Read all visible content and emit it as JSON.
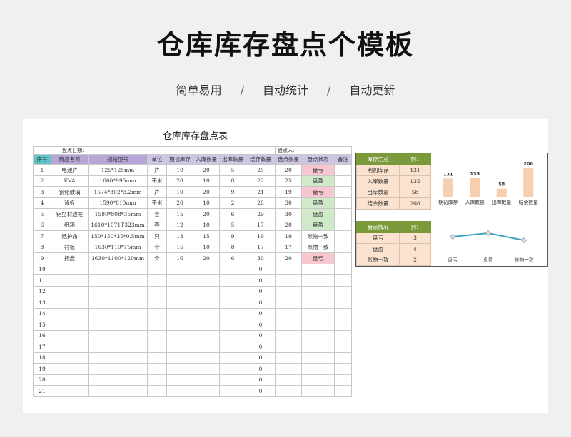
{
  "page": {
    "title": "仓库库存盘点个模板",
    "tags": [
      "简单易用",
      "自动统计",
      "自动更新"
    ],
    "separator": "/"
  },
  "sheet": {
    "title": "仓库库存盘点表",
    "date_label": "盘点日期:",
    "person_label": "盘点人:",
    "headers": [
      "序号",
      "商品名称",
      "规格型号",
      "单位",
      "期初库存",
      "入库数量",
      "出库数量",
      "结存数量",
      "盘点数量",
      "盘点状态",
      "备注"
    ],
    "rows": [
      [
        "1",
        "电池片",
        "125*125mm",
        "片",
        "10",
        "20",
        "5",
        "25",
        "20",
        "盘亏",
        ""
      ],
      [
        "2",
        "EVA",
        "1660*995mm",
        "平米",
        "20",
        "10",
        "8",
        "22",
        "25",
        "盘盈",
        ""
      ],
      [
        "3",
        "钢化玻璃",
        "1574*802*3.2mm",
        "片",
        "10",
        "20",
        "9",
        "21",
        "19",
        "盘亏",
        ""
      ],
      [
        "4",
        "背板",
        "1590*810mm",
        "平米",
        "20",
        "10",
        "2",
        "28",
        "30",
        "盘盈",
        ""
      ],
      [
        "5",
        "铝型材边框",
        "1580*808*35mm",
        "套",
        "15",
        "20",
        "6",
        "29",
        "30",
        "盘盈",
        ""
      ],
      [
        "6",
        "纸箱",
        "1610*1071T323mm",
        "套",
        "12",
        "10",
        "5",
        "17",
        "20",
        "盘盈",
        ""
      ],
      [
        "7",
        "纸护角",
        "150*150*35*0.5mm",
        "只",
        "13",
        "15",
        "9",
        "19",
        "19",
        "账物一致",
        ""
      ],
      [
        "8",
        "衬板",
        "1630*110*T5mm",
        "个",
        "15",
        "10",
        "8",
        "17",
        "17",
        "账物一致",
        ""
      ],
      [
        "9",
        "托盘",
        "1630*1100*120mm",
        "个",
        "16",
        "20",
        "6",
        "30",
        "20",
        "盘亏",
        ""
      ],
      [
        "10",
        "",
        "",
        "",
        "",
        "",
        "",
        "0",
        "",
        "",
        ""
      ],
      [
        "11",
        "",
        "",
        "",
        "",
        "",
        "",
        "0",
        "",
        "",
        ""
      ],
      [
        "12",
        "",
        "",
        "",
        "",
        "",
        "",
        "0",
        "",
        "",
        ""
      ],
      [
        "13",
        "",
        "",
        "",
        "",
        "",
        "",
        "0",
        "",
        "",
        ""
      ],
      [
        "14",
        "",
        "",
        "",
        "",
        "",
        "",
        "0",
        "",
        "",
        ""
      ],
      [
        "15",
        "",
        "",
        "",
        "",
        "",
        "",
        "0",
        "",
        "",
        ""
      ],
      [
        "16",
        "",
        "",
        "",
        "",
        "",
        "",
        "0",
        "",
        "",
        ""
      ],
      [
        "17",
        "",
        "",
        "",
        "",
        "",
        "",
        "0",
        "",
        "",
        ""
      ],
      [
        "18",
        "",
        "",
        "",
        "",
        "",
        "",
        "0",
        "",
        "",
        ""
      ],
      [
        "19",
        "",
        "",
        "",
        "",
        "",
        "",
        "0",
        "",
        "",
        ""
      ],
      [
        "20",
        "",
        "",
        "",
        "",
        "",
        "",
        "0",
        "",
        "",
        ""
      ],
      [
        "21",
        "",
        "",
        "",
        "",
        "",
        "",
        "0",
        "",
        "",
        ""
      ]
    ]
  },
  "summary": {
    "stock": {
      "header": [
        "库存汇总",
        "列1"
      ],
      "rows": [
        [
          "期初库存",
          "131"
        ],
        [
          "入库数量",
          "135"
        ],
        [
          "出库数量",
          "58"
        ],
        [
          "结余数量",
          "208"
        ]
      ]
    },
    "check": {
      "header": [
        "盘点情况",
        "列1"
      ],
      "rows": [
        [
          "盘亏",
          "3"
        ],
        [
          "盘盈",
          "4"
        ],
        [
          "账物一致",
          "2"
        ]
      ]
    }
  },
  "colors": {
    "header_teal": "#5cc6c6",
    "header_purple": "#b7a6d8",
    "loss_bg": "#f7c6cf",
    "gain_bg": "#cfe9c9",
    "summary_bg": "#fbe3d0",
    "summary_header": "#7a9a3a",
    "bar": "#f8cfae",
    "line": "#3ba3c3"
  },
  "chart_data": [
    {
      "type": "bar",
      "categories": [
        "期初库存",
        "入库数量",
        "出库数量",
        "结余数量"
      ],
      "values": [
        131,
        135,
        58,
        208
      ],
      "ylim": [
        0,
        230
      ]
    },
    {
      "type": "line",
      "categories": [
        "盘亏",
        "盘盈",
        "账物一致"
      ],
      "values": [
        3,
        4,
        2
      ],
      "ylim": [
        -2,
        6
      ]
    }
  ]
}
